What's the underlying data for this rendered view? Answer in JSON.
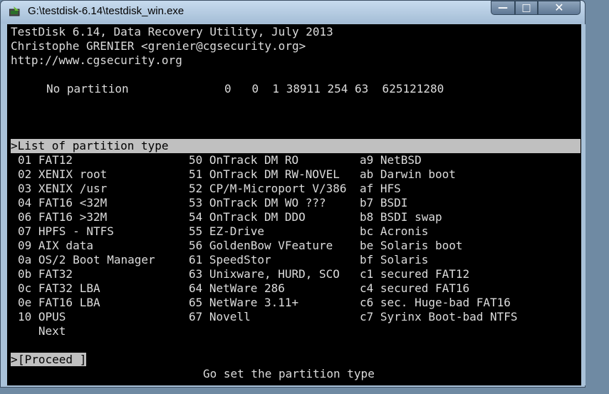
{
  "window": {
    "title": "G:\\testdisk-6.14\\testdisk_win.exe",
    "minimize": "—",
    "maximize": "□",
    "close": "✕"
  },
  "header": {
    "line1": "TestDisk 6.14, Data Recovery Utility, July 2013",
    "line2": "Christophe GRENIER <grenier@cgsecurity.org>",
    "line3": "http://www.cgsecurity.org"
  },
  "partition": {
    "label": "No partition",
    "values": "0   0  1 38911 254 63  625121280"
  },
  "menu_title": ">List of partition type",
  "types_col1": [
    "01 FAT12",
    "02 XENIX root",
    "03 XENIX /usr",
    "04 FAT16 <32M",
    "06 FAT16 >32M",
    "07 HPFS - NTFS",
    "09 AIX data",
    "0a OS/2 Boot Manager",
    "0b FAT32",
    "0c FAT32 LBA",
    "0e FAT16 LBA",
    "10 OPUS",
    "   Next"
  ],
  "types_col2": [
    "50 OnTrack DM RO",
    "51 OnTrack DM RW-NOVEL",
    "52 CP/M-Microport V/386",
    "53 OnTrack DM WO ???",
    "54 OnTrack DM DDO",
    "55 EZ-Drive",
    "56 GoldenBow VFeature",
    "61 SpeedStor",
    "63 Unixware, HURD, SCO",
    "64 NetWare 286",
    "65 NetWare 3.11+",
    "67 Novell"
  ],
  "types_col3": [
    "a9 NetBSD",
    "ab Darwin boot",
    "af HFS",
    "b7 BSDI",
    "b8 BSDI swap",
    "bc Acronis",
    "be Solaris boot",
    "bf Solaris",
    "c1 secured FAT12",
    "c4 secured FAT16",
    "c6 sec. Huge-bad FAT16",
    "c7 Syrinx Boot-bad NTFS"
  ],
  "proceed": {
    "prefix": ">",
    "label": "[Proceed ]"
  },
  "status": "Go set the partition type"
}
